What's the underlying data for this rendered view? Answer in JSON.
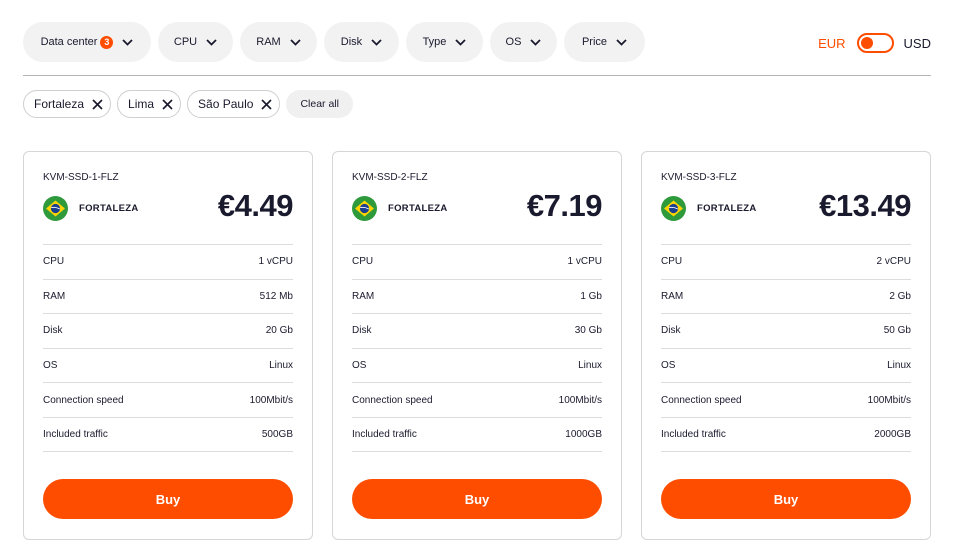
{
  "filters": [
    {
      "label": "Data center",
      "badge": "3"
    },
    {
      "label": "CPU"
    },
    {
      "label": "RAM"
    },
    {
      "label": "Disk"
    },
    {
      "label": "Type"
    },
    {
      "label": "OS"
    },
    {
      "label": "Price"
    }
  ],
  "currency": {
    "left": "EUR",
    "right": "USD",
    "active": "EUR"
  },
  "chips": [
    {
      "label": "Fortaleza"
    },
    {
      "label": "Lima"
    },
    {
      "label": "São Paulo"
    }
  ],
  "clear_all_label": "Clear all",
  "colors": {
    "accent": "#ff4d00",
    "text": "#1a1a2e"
  },
  "cards": [
    {
      "id": "KVM-SSD-1-FLZ",
      "location": "FORTALEZA",
      "flag": "brazil-flag-icon",
      "price": "€4.49",
      "specs": [
        {
          "label": "CPU",
          "value": "1 vCPU"
        },
        {
          "label": "RAM",
          "value": "512 Mb"
        },
        {
          "label": "Disk",
          "value": "20 Gb"
        },
        {
          "label": "OS",
          "value": "Linux"
        },
        {
          "label": "Connection speed",
          "value": "100Mbit/s"
        },
        {
          "label": "Included traffic",
          "value": "500GB"
        }
      ],
      "buy_label": "Buy"
    },
    {
      "id": "KVM-SSD-2-FLZ",
      "location": "FORTALEZA",
      "flag": "brazil-flag-icon",
      "price": "€7.19",
      "specs": [
        {
          "label": "CPU",
          "value": "1 vCPU"
        },
        {
          "label": "RAM",
          "value": "1 Gb"
        },
        {
          "label": "Disk",
          "value": "30 Gb"
        },
        {
          "label": "OS",
          "value": "Linux"
        },
        {
          "label": "Connection speed",
          "value": "100Mbit/s"
        },
        {
          "label": "Included traffic",
          "value": "1000GB"
        }
      ],
      "buy_label": "Buy"
    },
    {
      "id": "KVM-SSD-3-FLZ",
      "location": "FORTALEZA",
      "flag": "brazil-flag-icon",
      "price": "€13.49",
      "specs": [
        {
          "label": "CPU",
          "value": "2 vCPU"
        },
        {
          "label": "RAM",
          "value": "2 Gb"
        },
        {
          "label": "Disk",
          "value": "50 Gb"
        },
        {
          "label": "OS",
          "value": "Linux"
        },
        {
          "label": "Connection speed",
          "value": "100Mbit/s"
        },
        {
          "label": "Included traffic",
          "value": "2000GB"
        }
      ],
      "buy_label": "Buy"
    }
  ]
}
